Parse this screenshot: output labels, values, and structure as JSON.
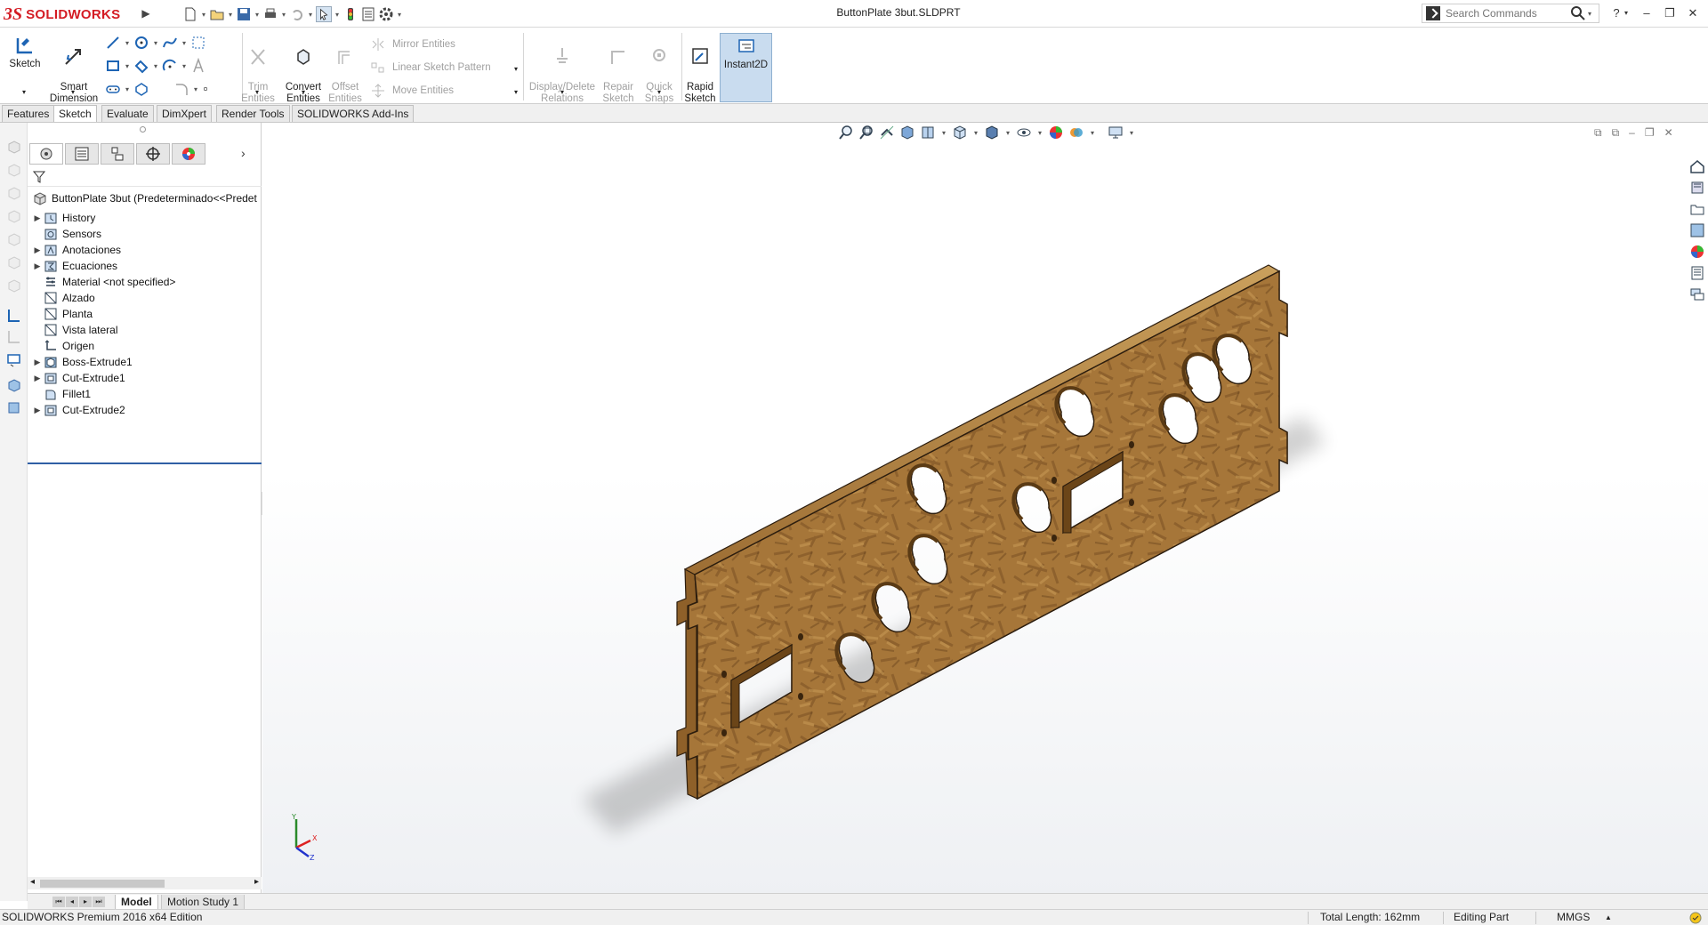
{
  "app": {
    "brand": "SOLIDWORKS",
    "doc_title": "ButtonPlate 3but.SLDPRT",
    "accent": "#d41c24"
  },
  "search": {
    "placeholder": "Search Commands"
  },
  "window": {
    "help": "?",
    "minimize": "–",
    "restore": "❐",
    "close": "✕"
  },
  "ribbon": {
    "sketch": "Sketch",
    "smart_dimension": "Smart\nDimension",
    "trim": "Trim\nEntities",
    "convert": "Convert\nEntities",
    "offset": "Offset\nEntities",
    "mirror": "Mirror Entities",
    "linear_pattern": "Linear Sketch Pattern",
    "move": "Move Entities",
    "display_delete": "Display/Delete\nRelations",
    "repair": "Repair\nSketch",
    "quick_snaps": "Quick\nSnaps",
    "rapid": "Rapid\nSketch",
    "instant2d": "Instant2D"
  },
  "tabs": [
    "Features",
    "Sketch",
    "Evaluate",
    "DimXpert",
    "Render Tools",
    "SOLIDWORKS Add-Ins"
  ],
  "active_tab": "Sketch",
  "tree": {
    "root": "ButtonPlate 3but  (Predeterminado<<Predet",
    "items": [
      {
        "label": "History",
        "exp": "▶",
        "icon": "history-folder-icon"
      },
      {
        "label": "Sensors",
        "exp": "",
        "icon": "sensors-icon"
      },
      {
        "label": "Anotaciones",
        "exp": "▶",
        "icon": "annotations-icon"
      },
      {
        "label": "Ecuaciones",
        "exp": "▶",
        "icon": "equations-icon"
      },
      {
        "label": "Material <not specified>",
        "exp": "",
        "icon": "material-icon"
      },
      {
        "label": "Alzado",
        "exp": "",
        "icon": "plane-icon"
      },
      {
        "label": "Planta",
        "exp": "",
        "icon": "plane-icon"
      },
      {
        "label": "Vista lateral",
        "exp": "",
        "icon": "plane-icon"
      },
      {
        "label": "Origen",
        "exp": "",
        "icon": "origin-icon"
      },
      {
        "label": "Boss-Extrude1",
        "exp": "▶",
        "icon": "boss-extrude-icon"
      },
      {
        "label": "Cut-Extrude1",
        "exp": "▶",
        "icon": "cut-extrude-icon"
      },
      {
        "label": "Fillet1",
        "exp": "",
        "icon": "fillet-icon"
      },
      {
        "label": "Cut-Extrude2",
        "exp": "▶",
        "icon": "cut-extrude-icon"
      }
    ]
  },
  "bottom_tabs": {
    "model": "Model",
    "motion": "Motion Study 1"
  },
  "status": {
    "edition": "SOLIDWORKS Premium 2016 x64 Edition",
    "total_length": "Total Length: 162mm",
    "mode": "Editing Part",
    "units": "MMGS"
  },
  "triad": {
    "x": "X",
    "y": "Y",
    "z": "Z"
  },
  "colors": {
    "wood": "#a9773c",
    "wood_dark": "#7b5224",
    "edge": "#2c1d0e"
  }
}
